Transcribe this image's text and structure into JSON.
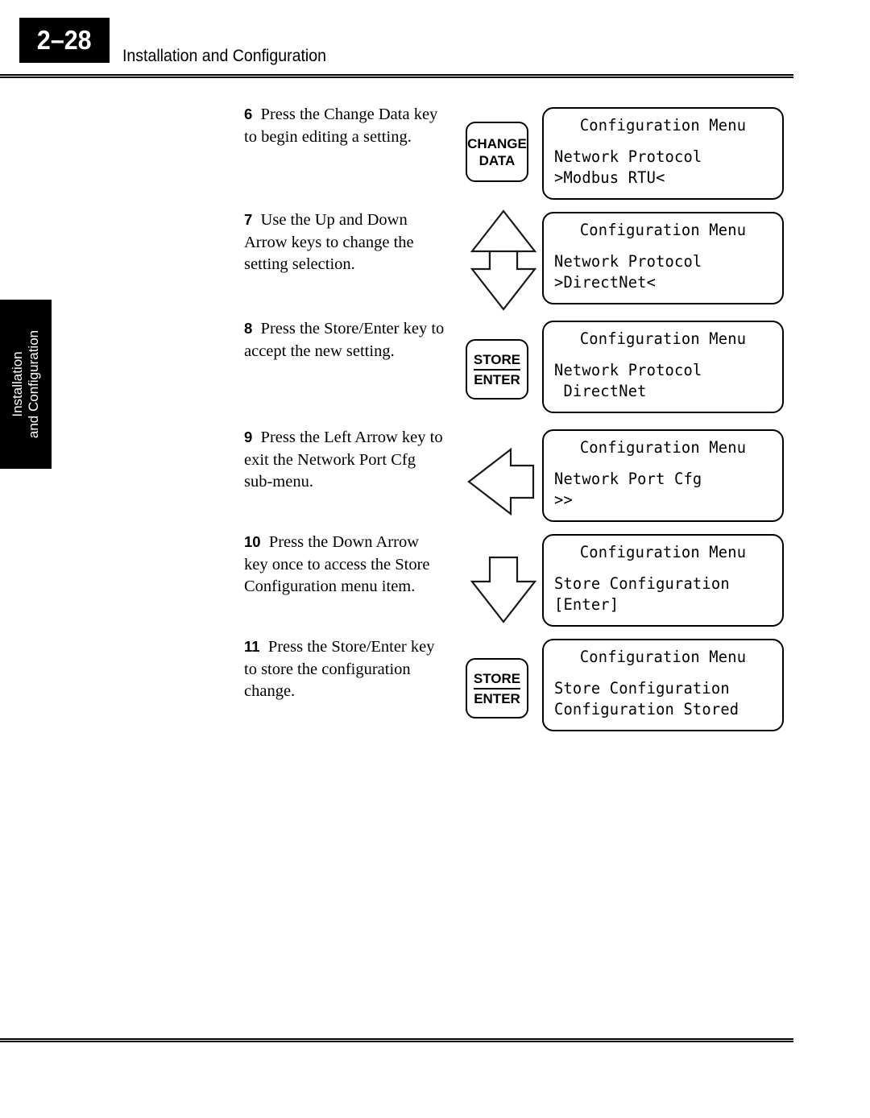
{
  "header": {
    "page_number": "2–28",
    "title": "Installation and Configuration"
  },
  "side_tab": {
    "label_line1": "Installation",
    "label_line2": "and Configuration"
  },
  "steps": [
    {
      "number": "6",
      "text": "Press the Change Data key to begin editing a setting.",
      "graphic": "key-change-data"
    },
    {
      "number": "7",
      "text": "Use the Up and Down Arrow keys to change the setting selection.",
      "graphic": "arrow-up-down"
    },
    {
      "number": "8",
      "text": "Press the Store/Enter key to accept the new setting.",
      "graphic": "key-store-enter"
    },
    {
      "number": "9",
      "text": "Press the Left Arrow key to exit the Network Port Cfg sub-menu.",
      "graphic": "arrow-left"
    },
    {
      "number": "10",
      "text": "Press the Down Arrow key once to access the Store Configuration menu item.",
      "graphic": "arrow-down"
    },
    {
      "number": "11",
      "text": "Press the Store/Enter key to store the configuration change.",
      "graphic": "key-store-enter"
    }
  ],
  "keys": {
    "change_data": {
      "line1": "CHANGE",
      "line2": "DATA"
    },
    "store_enter": {
      "line1": "STORE",
      "line2": "ENTER"
    }
  },
  "displays": [
    {
      "title": "Configuration Menu",
      "line1": "Network Protocol",
      "line2": ">Modbus RTU<"
    },
    {
      "title": "Configuration Menu",
      "line1": "Network Protocol",
      "line2": ">DirectNet<"
    },
    {
      "title": "Configuration Menu",
      "line1": "Network Protocol",
      "line2": " DirectNet"
    },
    {
      "title": "Configuration Menu",
      "line1": "Network Port Cfg",
      "line2": ">>"
    },
    {
      "title": "Configuration Menu",
      "line1": "Store Configuration",
      "line2": "[Enter]"
    },
    {
      "title": "Configuration Menu",
      "line1": "Store Configuration",
      "line2": "Configuration Stored"
    }
  ],
  "colors": {
    "ink": "#000000",
    "paper": "#ffffff",
    "tab_background": "#000000",
    "tab_text": "#ffffff"
  }
}
